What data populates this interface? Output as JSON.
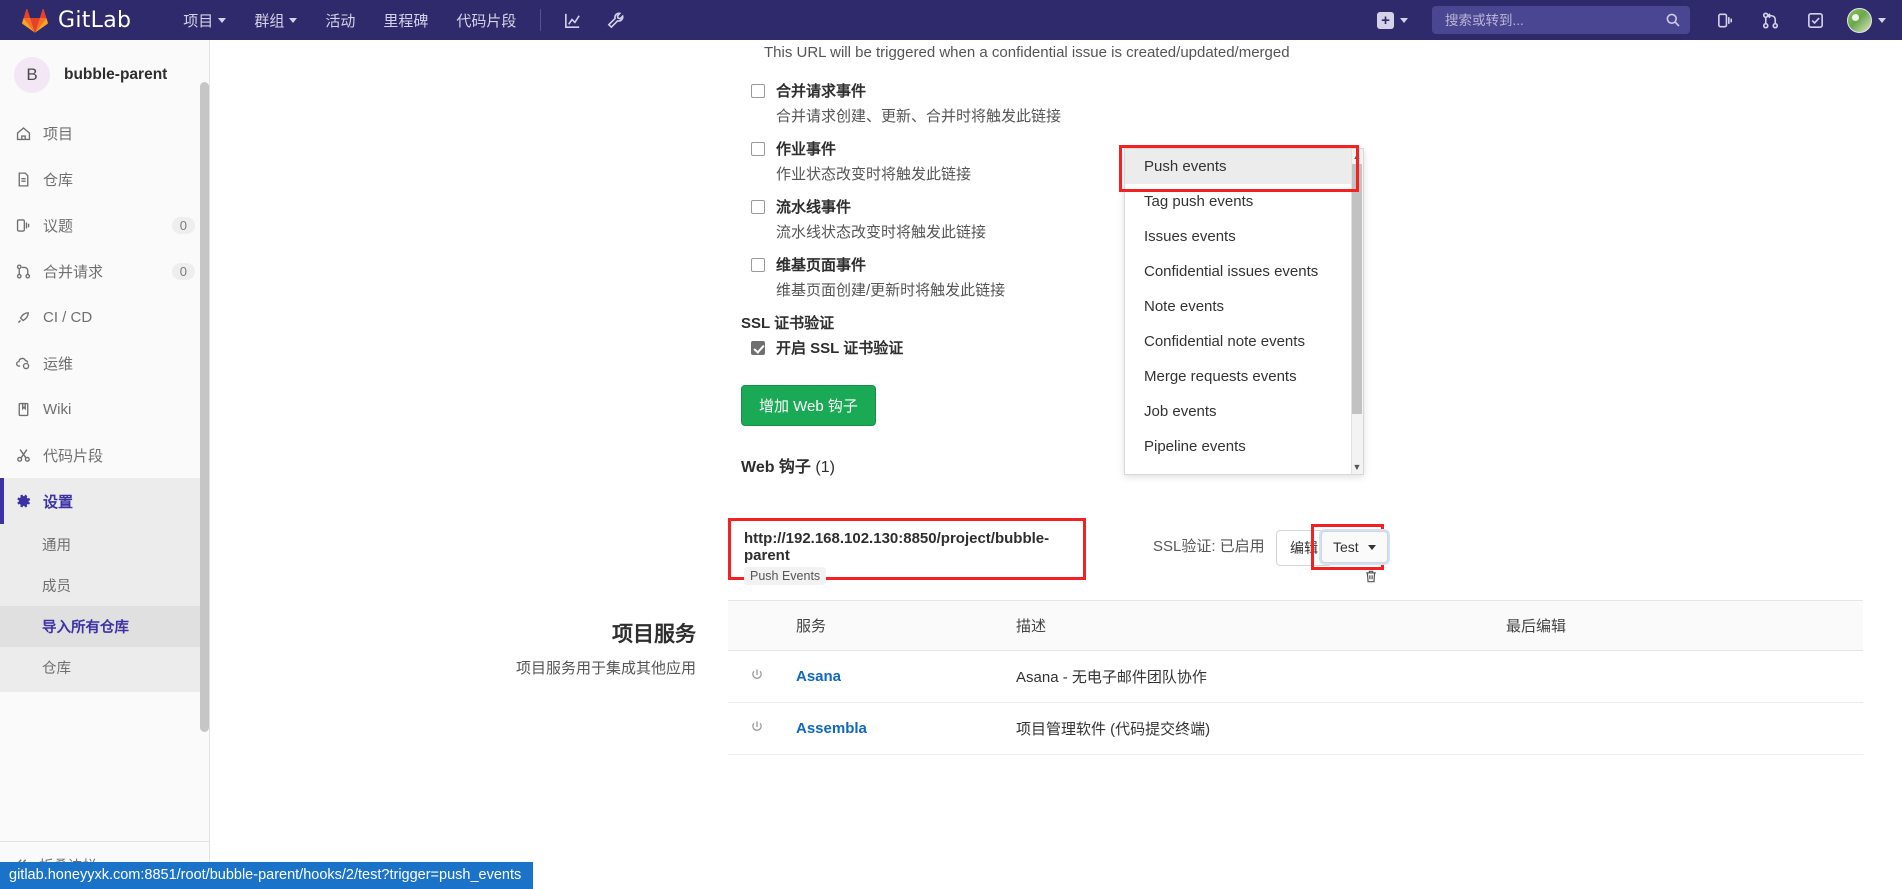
{
  "navbar": {
    "brand": "GitLab",
    "logo_icon": "gitlab-fox-logo",
    "links": [
      {
        "label": "项目",
        "has_caret": true,
        "name": "nav-projects"
      },
      {
        "label": "群组",
        "has_caret": true,
        "name": "nav-groups"
      },
      {
        "label": "活动",
        "has_caret": false,
        "name": "nav-activity"
      },
      {
        "label": "里程碑",
        "has_caret": false,
        "name": "nav-milestones"
      },
      {
        "label": "代码片段",
        "has_caret": false,
        "name": "nav-snippets"
      }
    ],
    "icon_buttons": [
      {
        "name": "analytics-icon",
        "title": "分析"
      },
      {
        "name": "wrench-icon",
        "title": "管理"
      }
    ],
    "plus_label": "+",
    "search": {
      "placeholder": "搜索或转到...",
      "value": "",
      "icon": "search-icon"
    },
    "right_icons": [
      {
        "name": "issues-icon"
      },
      {
        "name": "merge-requests-icon"
      },
      {
        "name": "todos-icon"
      }
    ],
    "avatar_name": "user-avatar"
  },
  "sidebar": {
    "project": {
      "initial": "B",
      "name": "bubble-parent"
    },
    "items": [
      {
        "label": "项目",
        "icon": "home-icon",
        "badge": "",
        "active": false
      },
      {
        "label": "仓库",
        "icon": "file-icon",
        "badge": "",
        "active": false
      },
      {
        "label": "议题",
        "icon": "issues-icon",
        "badge": "0",
        "active": false
      },
      {
        "label": "合并请求",
        "icon": "merge-request-icon",
        "badge": "0",
        "active": false
      },
      {
        "label": "CI / CD",
        "icon": "rocket-icon",
        "badge": "",
        "active": false
      },
      {
        "label": "运维",
        "icon": "cloud-gear-icon",
        "badge": "",
        "active": false
      },
      {
        "label": "Wiki",
        "icon": "book-icon",
        "badge": "",
        "active": false
      },
      {
        "label": "代码片段",
        "icon": "scissors-icon",
        "badge": "",
        "active": false
      },
      {
        "label": "设置",
        "icon": "gear-icon",
        "badge": "",
        "active": true
      }
    ],
    "settings_submenu": [
      {
        "label": "通用",
        "active": false
      },
      {
        "label": "成员",
        "active": false
      },
      {
        "label": "导入所有仓库",
        "active": true
      },
      {
        "label": "仓库",
        "active": false
      }
    ],
    "collapse_label": "折叠边栏",
    "collapse_icon": "double-chevron-left-icon"
  },
  "webhook_form": {
    "url_note": "This URL will be triggered when a confidential issue is created/updated/merged",
    "events": [
      {
        "title": "合并请求事件",
        "desc": "合并请求创建、更新、合并时将触发此链接",
        "checked": false
      },
      {
        "title": "作业事件",
        "desc": "作业状态改变时将触发此链接",
        "checked": false
      },
      {
        "title": "流水线事件",
        "desc": "流水线状态改变时将触发此链接",
        "checked": false
      },
      {
        "title": "维基页面事件",
        "desc": "维基页面创建/更新时将触发此链接",
        "checked": false
      }
    ],
    "ssl_section_title": "SSL 证书验证",
    "ssl_checkbox": {
      "label": "开启 SSL 证书验证",
      "checked": true
    },
    "submit_label": "增加 Web 钩子"
  },
  "hooks_list": {
    "heading_main": "Web 钩子",
    "heading_count": "(1)",
    "entry": {
      "url": "http://192.168.102.130:8850/project/bubble-parent",
      "tag": "Push Events",
      "ssl_status": "SSL验证: 已启用",
      "edit_label": "编辑",
      "test_label": "Test",
      "delete_icon": "trash-icon"
    }
  },
  "dropdown": {
    "items": [
      {
        "label": "Push events",
        "highlighted": true
      },
      {
        "label": "Tag push events",
        "highlighted": false
      },
      {
        "label": "Issues events",
        "highlighted": false
      },
      {
        "label": "Confidential issues events",
        "highlighted": false
      },
      {
        "label": "Note events",
        "highlighted": false
      },
      {
        "label": "Confidential note events",
        "highlighted": false
      },
      {
        "label": "Merge requests events",
        "highlighted": false
      },
      {
        "label": "Job events",
        "highlighted": false
      },
      {
        "label": "Pipeline events",
        "highlighted": false
      }
    ],
    "scroll_up_icon": "caret-up-icon",
    "scroll_down_icon": "caret-down-icon"
  },
  "services": {
    "title": "项目服务",
    "subtitle": "项目服务用于集成其他应用",
    "columns": [
      "",
      "服务",
      "描述",
      "最后编辑"
    ],
    "rows": [
      {
        "icon": "power-icon",
        "name": "Asana",
        "desc": "Asana - 无电子邮件团队协作",
        "last_edit": ""
      },
      {
        "icon": "power-icon",
        "name": "Assembla",
        "desc": "项目管理软件 (代码提交终端)",
        "last_edit": ""
      }
    ]
  },
  "statusbar": {
    "url": "gitlab.honeyyxk.com:8851/root/bubble-parent/hooks/2/test?trigger=push_events"
  },
  "colors": {
    "navbar_bg": "#2f2a6b",
    "accent_green": "#1aaa55",
    "highlight_red": "#f32121",
    "link_blue": "#1068bf",
    "status_blue": "#1a73c8",
    "active_purple": "#3c32a5"
  }
}
